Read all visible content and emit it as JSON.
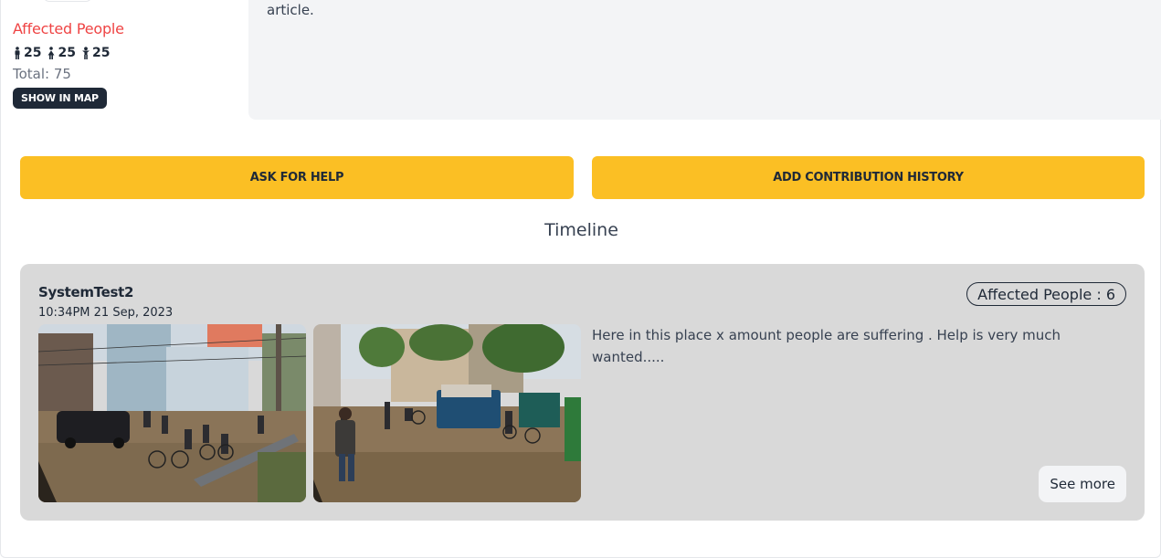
{
  "summary": {
    "affected_title": "Affected People",
    "counts": [
      {
        "icon": "man-icon",
        "value": "25"
      },
      {
        "icon": "woman-icon",
        "value": "25"
      },
      {
        "icon": "child-icon",
        "value": "25"
      }
    ],
    "total_label": "Total: 75",
    "show_map_label": "SHOW IN MAP"
  },
  "article": {
    "text": "article."
  },
  "actions": {
    "ask_help_label": "ASK FOR HELP",
    "add_contribution_label": "ADD CONTRIBUTION HISTORY"
  },
  "timeline": {
    "title": "Timeline",
    "entries": [
      {
        "user": "SystemTest2",
        "timestamp": "10:34PM 21 Sep, 2023",
        "affected_badge": "Affected People : 6",
        "description": "Here in this place x amount people are suffering . Help is very much wanted.....",
        "see_more_label": "See more",
        "photos": [
          "flood-street-photo",
          "flood-street-photo"
        ]
      }
    ]
  },
  "colors": {
    "accent_yellow": "#fbbf24",
    "alert_red": "#ef4444",
    "dark_button": "#1f2937",
    "card_gray": "#d9d9d9"
  }
}
